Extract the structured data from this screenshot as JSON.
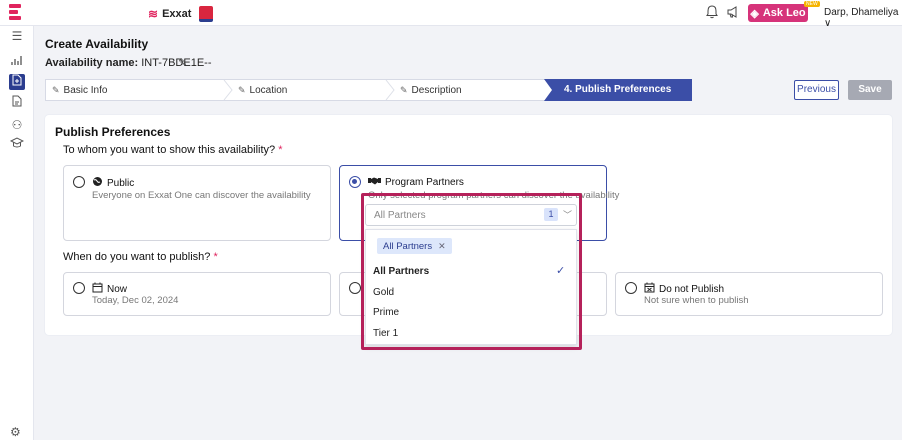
{
  "topbar": {
    "brand_name": "Exxat",
    "ask_leo": "Ask Leo",
    "new_badge": "NEW",
    "user_name": "Darp, Dhameliya",
    "user_chevron": "∨"
  },
  "header": {
    "title": "Create Availability",
    "name_label": "Availability name:",
    "name_value": "INT-7BDE1E--"
  },
  "steps": [
    {
      "label": "Basic Info"
    },
    {
      "label": "Location"
    },
    {
      "label": "Description"
    },
    {
      "label": "4.  Publish Preferences"
    }
  ],
  "actions": {
    "previous": "Previous",
    "save": "Save"
  },
  "section": {
    "title": "Publish Preferences",
    "q1": "To whom you want to show this availability?",
    "q2": "When do you want to publish?",
    "required_mark": "*"
  },
  "audience_options": [
    {
      "title": "Public",
      "desc": "Everyone on Exxat One can discover the availability",
      "selected": false
    },
    {
      "title": "Program Partners",
      "desc": "Only selected program partners can discover the availability",
      "selected": true
    }
  ],
  "partners_select": {
    "placeholder": "All Partners",
    "count": "1",
    "chip": "All Partners",
    "options": [
      "All Partners",
      "Gold",
      "Prime",
      "Tier 1"
    ],
    "selected_option": "All Partners"
  },
  "publish_options": [
    {
      "title": "Now",
      "desc": "Today, Dec 02, 2024",
      "selected": false
    },
    {
      "title": "Do not Publish",
      "desc": "Not sure when to publish",
      "selected": false
    }
  ],
  "colors": {
    "primary": "#3b4ea7",
    "accent": "#e0245e",
    "highlight_border": "#b5215a",
    "ask_leo": "#d6337a"
  }
}
